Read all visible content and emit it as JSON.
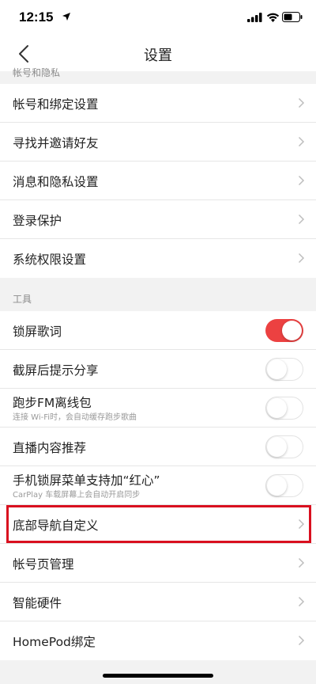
{
  "status_bar": {
    "time": "12:15",
    "icons": [
      "location-arrow-icon",
      "signal-icon",
      "wifi-icon",
      "battery-icon"
    ]
  },
  "nav": {
    "title": "设置",
    "back_icon": "chevron-left-icon"
  },
  "sections": {
    "account": {
      "header": "帐号和隐私",
      "items": [
        {
          "label": "帐号和绑定设置"
        },
        {
          "label": "寻找并邀请好友"
        },
        {
          "label": "消息和隐私设置"
        },
        {
          "label": "登录保护"
        },
        {
          "label": "系统权限设置"
        }
      ]
    },
    "tools": {
      "header": "工具",
      "items": [
        {
          "label": "锁屏歌词",
          "toggle": true
        },
        {
          "label": "截屏后提示分享",
          "toggle": false
        },
        {
          "label": "跑步FM离线包",
          "sub": "连接 Wi-Fi时，会自动缓存跑步歌曲",
          "toggle": false
        },
        {
          "label": "直播内容推荐",
          "toggle": false
        },
        {
          "label": "手机锁屏菜单支持加“红心”",
          "sub": "CarPlay 车载屏幕上会自动开启同步",
          "toggle": false
        },
        {
          "label": "底部导航自定义",
          "highlighted": true
        },
        {
          "label": "帐号页管理"
        },
        {
          "label": "智能硬件"
        },
        {
          "label": "HomePod绑定"
        }
      ]
    }
  },
  "colors": {
    "accent": "#ec4141",
    "highlight_border": "#d9101f",
    "background": "#f2f2f2"
  }
}
